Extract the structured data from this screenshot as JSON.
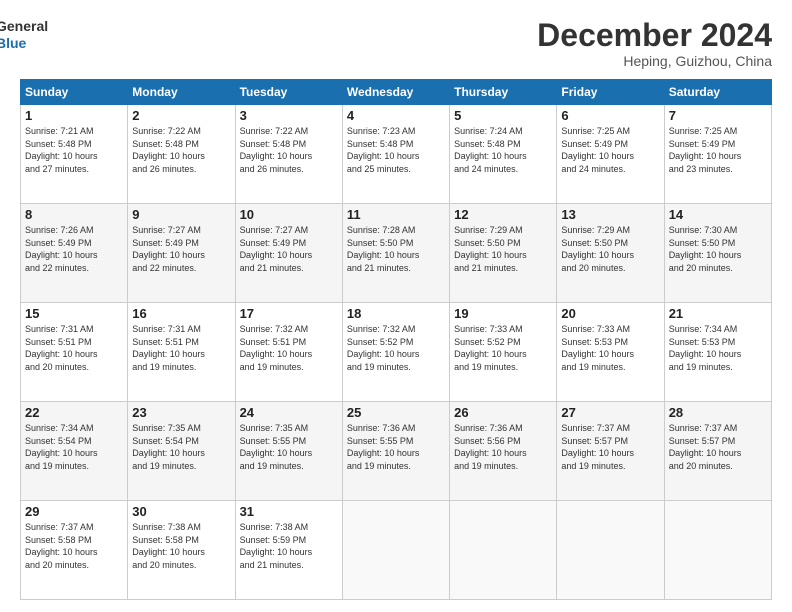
{
  "logo": {
    "line1": "General",
    "line2": "Blue"
  },
  "title": "December 2024",
  "location": "Heping, Guizhou, China",
  "days_of_week": [
    "Sunday",
    "Monday",
    "Tuesday",
    "Wednesday",
    "Thursday",
    "Friday",
    "Saturday"
  ],
  "weeks": [
    [
      {
        "day": "1",
        "text": "Sunrise: 7:21 AM\nSunset: 5:48 PM\nDaylight: 10 hours\nand 27 minutes."
      },
      {
        "day": "2",
        "text": "Sunrise: 7:22 AM\nSunset: 5:48 PM\nDaylight: 10 hours\nand 26 minutes."
      },
      {
        "day": "3",
        "text": "Sunrise: 7:22 AM\nSunset: 5:48 PM\nDaylight: 10 hours\nand 26 minutes."
      },
      {
        "day": "4",
        "text": "Sunrise: 7:23 AM\nSunset: 5:48 PM\nDaylight: 10 hours\nand 25 minutes."
      },
      {
        "day": "5",
        "text": "Sunrise: 7:24 AM\nSunset: 5:48 PM\nDaylight: 10 hours\nand 24 minutes."
      },
      {
        "day": "6",
        "text": "Sunrise: 7:25 AM\nSunset: 5:49 PM\nDaylight: 10 hours\nand 24 minutes."
      },
      {
        "day": "7",
        "text": "Sunrise: 7:25 AM\nSunset: 5:49 PM\nDaylight: 10 hours\nand 23 minutes."
      }
    ],
    [
      {
        "day": "8",
        "text": "Sunrise: 7:26 AM\nSunset: 5:49 PM\nDaylight: 10 hours\nand 22 minutes."
      },
      {
        "day": "9",
        "text": "Sunrise: 7:27 AM\nSunset: 5:49 PM\nDaylight: 10 hours\nand 22 minutes."
      },
      {
        "day": "10",
        "text": "Sunrise: 7:27 AM\nSunset: 5:49 PM\nDaylight: 10 hours\nand 21 minutes."
      },
      {
        "day": "11",
        "text": "Sunrise: 7:28 AM\nSunset: 5:50 PM\nDaylight: 10 hours\nand 21 minutes."
      },
      {
        "day": "12",
        "text": "Sunrise: 7:29 AM\nSunset: 5:50 PM\nDaylight: 10 hours\nand 21 minutes."
      },
      {
        "day": "13",
        "text": "Sunrise: 7:29 AM\nSunset: 5:50 PM\nDaylight: 10 hours\nand 20 minutes."
      },
      {
        "day": "14",
        "text": "Sunrise: 7:30 AM\nSunset: 5:50 PM\nDaylight: 10 hours\nand 20 minutes."
      }
    ],
    [
      {
        "day": "15",
        "text": "Sunrise: 7:31 AM\nSunset: 5:51 PM\nDaylight: 10 hours\nand 20 minutes."
      },
      {
        "day": "16",
        "text": "Sunrise: 7:31 AM\nSunset: 5:51 PM\nDaylight: 10 hours\nand 19 minutes."
      },
      {
        "day": "17",
        "text": "Sunrise: 7:32 AM\nSunset: 5:51 PM\nDaylight: 10 hours\nand 19 minutes."
      },
      {
        "day": "18",
        "text": "Sunrise: 7:32 AM\nSunset: 5:52 PM\nDaylight: 10 hours\nand 19 minutes."
      },
      {
        "day": "19",
        "text": "Sunrise: 7:33 AM\nSunset: 5:52 PM\nDaylight: 10 hours\nand 19 minutes."
      },
      {
        "day": "20",
        "text": "Sunrise: 7:33 AM\nSunset: 5:53 PM\nDaylight: 10 hours\nand 19 minutes."
      },
      {
        "day": "21",
        "text": "Sunrise: 7:34 AM\nSunset: 5:53 PM\nDaylight: 10 hours\nand 19 minutes."
      }
    ],
    [
      {
        "day": "22",
        "text": "Sunrise: 7:34 AM\nSunset: 5:54 PM\nDaylight: 10 hours\nand 19 minutes."
      },
      {
        "day": "23",
        "text": "Sunrise: 7:35 AM\nSunset: 5:54 PM\nDaylight: 10 hours\nand 19 minutes."
      },
      {
        "day": "24",
        "text": "Sunrise: 7:35 AM\nSunset: 5:55 PM\nDaylight: 10 hours\nand 19 minutes."
      },
      {
        "day": "25",
        "text": "Sunrise: 7:36 AM\nSunset: 5:55 PM\nDaylight: 10 hours\nand 19 minutes."
      },
      {
        "day": "26",
        "text": "Sunrise: 7:36 AM\nSunset: 5:56 PM\nDaylight: 10 hours\nand 19 minutes."
      },
      {
        "day": "27",
        "text": "Sunrise: 7:37 AM\nSunset: 5:57 PM\nDaylight: 10 hours\nand 19 minutes."
      },
      {
        "day": "28",
        "text": "Sunrise: 7:37 AM\nSunset: 5:57 PM\nDaylight: 10 hours\nand 20 minutes."
      }
    ],
    [
      {
        "day": "29",
        "text": "Sunrise: 7:37 AM\nSunset: 5:58 PM\nDaylight: 10 hours\nand 20 minutes."
      },
      {
        "day": "30",
        "text": "Sunrise: 7:38 AM\nSunset: 5:58 PM\nDaylight: 10 hours\nand 20 minutes."
      },
      {
        "day": "31",
        "text": "Sunrise: 7:38 AM\nSunset: 5:59 PM\nDaylight: 10 hours\nand 21 minutes."
      },
      {
        "day": "",
        "text": ""
      },
      {
        "day": "",
        "text": ""
      },
      {
        "day": "",
        "text": ""
      },
      {
        "day": "",
        "text": ""
      }
    ]
  ]
}
